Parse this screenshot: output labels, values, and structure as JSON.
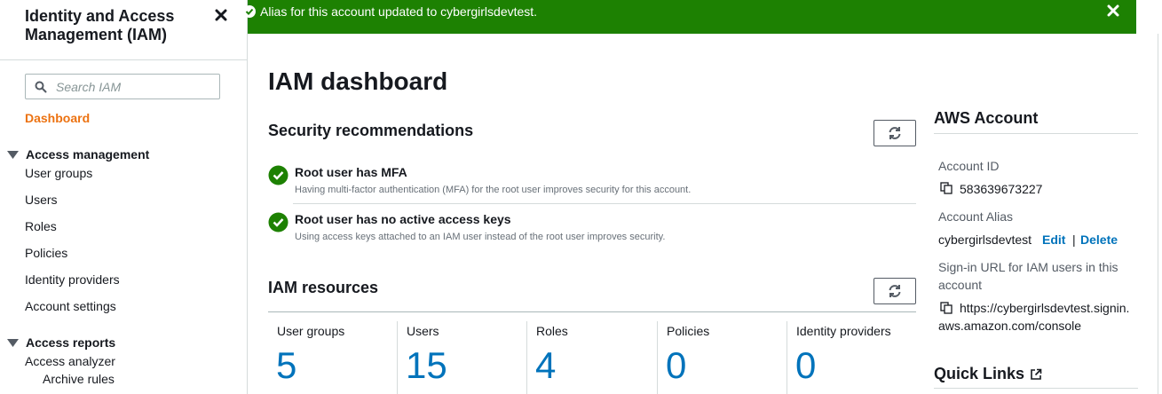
{
  "sidebar": {
    "title": "Identity and Access Management (IAM)",
    "search_placeholder": "Search IAM",
    "dashboard": "Dashboard",
    "access_management": {
      "label": "Access management",
      "items": [
        "User groups",
        "Users",
        "Roles",
        "Policies",
        "Identity providers",
        "Account settings"
      ]
    },
    "access_reports": {
      "label": "Access reports",
      "items": [
        "Access analyzer",
        "Archive rules"
      ]
    }
  },
  "flash": {
    "message": "Alias for this account updated to cybergirlsdevtest."
  },
  "main": {
    "title": "IAM dashboard",
    "security": {
      "heading": "Security recommendations",
      "items": [
        {
          "title": "Root user has MFA",
          "desc": "Having multi-factor authentication (MFA) for the root user improves security for this account."
        },
        {
          "title": "Root user has no active access keys",
          "desc": "Using access keys attached to an IAM user instead of the root user improves security."
        }
      ]
    },
    "resources": {
      "heading": "IAM resources",
      "cells": [
        {
          "label": "User groups",
          "value": "5"
        },
        {
          "label": "Users",
          "value": "15"
        },
        {
          "label": "Roles",
          "value": "4"
        },
        {
          "label": "Policies",
          "value": "0"
        },
        {
          "label": "Identity providers",
          "value": "0"
        }
      ]
    }
  },
  "account": {
    "heading": "AWS Account",
    "id_label": "Account ID",
    "id_value": "583639673227",
    "alias_label": "Account Alias",
    "alias_value": "cybergirlsdevtest",
    "edit": "Edit",
    "separator": "|",
    "delete": "Delete",
    "signin_label_line1": "Sign-in URL for IAM users in this",
    "signin_label_line2": "account",
    "signin_url_line1": "https://cybergirlsdevtest.signin.",
    "signin_url_line2": "aws.amazon.com/console"
  },
  "quick_links": {
    "heading": "Quick Links"
  },
  "colors": {
    "success_banner": "#1d8102",
    "accent_orange": "#ec7211",
    "link_blue": "#0073bb",
    "success_check": "#1d8102"
  },
  "icons": [
    "close-icon",
    "search-icon",
    "caret-down-icon",
    "success-icon",
    "refresh-icon",
    "copy-icon",
    "external-link-icon"
  ]
}
